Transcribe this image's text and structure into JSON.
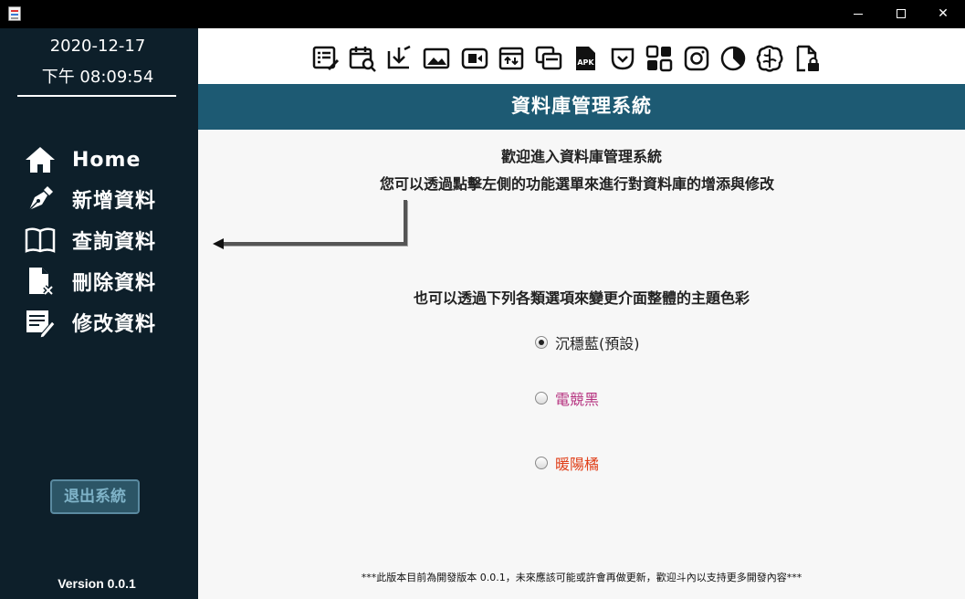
{
  "window": {
    "minimize_glyph": "",
    "maximize_glyph": "",
    "close_glyph": "✕"
  },
  "sidebar": {
    "date": "2020-12-17",
    "time": "下午 08:09:54",
    "items": [
      {
        "label": "Home",
        "icon": "home-icon"
      },
      {
        "label": "新增資料",
        "icon": "pen-nib-icon"
      },
      {
        "label": "查詢資料",
        "icon": "open-book-icon"
      },
      {
        "label": "刪除資料",
        "icon": "delete-file-icon"
      },
      {
        "label": "修改資料",
        "icon": "edit-list-icon"
      }
    ],
    "exit_label": "退出系統",
    "version": "Version 0.0.1"
  },
  "toolbar": {
    "icons": [
      "list-edit-icon",
      "calendar-search-icon",
      "download-check-icon",
      "image-icon",
      "video-icon",
      "calendar-upload-icon",
      "copy-icon",
      "apk-file-icon",
      "pocket-icon",
      "apps-grid-icon",
      "instagram-icon",
      "pie-chart-icon",
      "brain-icon",
      "file-lock-icon"
    ],
    "apk_text": "APK"
  },
  "main": {
    "banner_title": "資料庫管理系統",
    "welcome_line1": "歡迎進入資料庫管理系統",
    "welcome_line2": "您可以透過點擊左側的功能選單來進行對資料庫的增添與修改",
    "theme_prompt": "也可以透過下列各類選項來變更介面整體的主題色彩",
    "themes": [
      {
        "label": "沉穩藍(預設)",
        "color": "#222222",
        "selected": true
      },
      {
        "label": "電競黑",
        "color": "#b5317f",
        "selected": false
      },
      {
        "label": "暖陽橘",
        "color": "#e0401a",
        "selected": false
      }
    ],
    "footer": "***此版本目前為開發版本 0.0.1，未來應該可能或許會再做更新，歡迎斗內以支持更多開發內容***"
  },
  "colors": {
    "sidebar_bg": "#0d1f2a",
    "banner_bg": "#1d5a73",
    "main_bg": "#f7f7f7"
  }
}
